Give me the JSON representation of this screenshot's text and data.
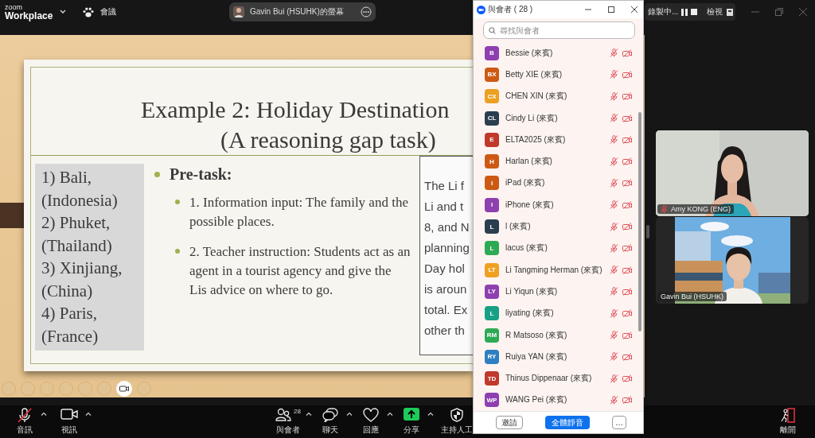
{
  "app_bar": {
    "logo_small": "zoom",
    "logo_large": "Workplace",
    "meeting_label": "會議",
    "share_pill": "Gavin Bui (HSUHK)的螢幕",
    "recording": "錄製中...",
    "view": "檢視"
  },
  "slide": {
    "title": "Example 2: Holiday Destination",
    "subtitle": "(A reasoning gap task)",
    "places": [
      "1) Bali,",
      "(Indonesia)",
      "2) Phuket,",
      "(Thailand)",
      "3) Xinjiang,",
      "(China)",
      "4) Paris,",
      "(France)"
    ],
    "bullet": "Pre-task:",
    "sub_bullets": [
      "1. Information input: The family and the possible places.",
      "2. Teacher instruction: Students act as an agent in a tourist agency and give the Lis advice on where to go."
    ],
    "box_lines": [
      "The Li f",
      "Li and t",
      "8, and N",
      "planning",
      "Day hol",
      "is aroun",
      "total. Ex",
      "other th"
    ]
  },
  "participants_panel": {
    "title": "與會者 ( 28 )",
    "search": {
      "placeholder": "尋找與會者"
    },
    "participants": [
      {
        "initials": "B",
        "name": "Bessie (來賓)",
        "color": "#8e3fb0",
        "audio_muted": true,
        "video_off": true
      },
      {
        "initials": "BX",
        "name": "Betty XIE (來賓)",
        "color": "#cc5a14",
        "audio_muted": true,
        "video_off": true
      },
      {
        "initials": "CX",
        "name": "CHEN XIN (來賓)",
        "color": "#eba022",
        "audio_muted": true,
        "video_off": true
      },
      {
        "initials": "CL",
        "name": "Cindy Li (來賓)",
        "color": "#2b3e50",
        "audio_muted": true,
        "video_off": true
      },
      {
        "initials": "E",
        "name": "ELTA2025 (來賓)",
        "color": "#c0392b",
        "audio_muted": true,
        "video_off": true
      },
      {
        "initials": "H",
        "name": "Harlan (來賓)",
        "color": "#cc5a14",
        "audio_muted": true,
        "video_off": true
      },
      {
        "initials": "I",
        "name": "iPad (來賓)",
        "color": "#cc5a14",
        "audio_muted": true,
        "video_off": true
      },
      {
        "initials": "I",
        "name": "iPhone (來賓)",
        "color": "#8e3fb0",
        "audio_muted": true,
        "video_off": true
      },
      {
        "initials": "L",
        "name": "l (來賓)",
        "color": "#2b3e50",
        "audio_muted": true,
        "video_off": true
      },
      {
        "initials": "L",
        "name": "lacus (來賓)",
        "color": "#2eaa55",
        "audio_muted": true,
        "video_off": true
      },
      {
        "initials": "LT",
        "name": "Li Tangming Herman (來賓)",
        "color": "#f0a020",
        "audio_muted": true,
        "video_off": true
      },
      {
        "initials": "LY",
        "name": "Li Yiqun (來賓)",
        "color": "#8e3fb0",
        "audio_muted": true,
        "video_off": true
      },
      {
        "initials": "L",
        "name": "liyating (來賓)",
        "color": "#17a084",
        "audio_muted": true,
        "video_off": true
      },
      {
        "initials": "RM",
        "name": "R Matsoso (來賓)",
        "color": "#2eaa55",
        "audio_muted": true,
        "video_off": true
      },
      {
        "initials": "RY",
        "name": "Ruiya YAN (來賓)",
        "color": "#2e7fc1",
        "audio_muted": true,
        "video_off": true
      },
      {
        "initials": "TD",
        "name": "Thinus Dippenaar (來賓)",
        "color": "#c0392b",
        "audio_muted": true,
        "video_off": true
      },
      {
        "initials": "WP",
        "name": "WANG Pei (來賓)",
        "color": "#8e3fb0",
        "audio_muted": true,
        "video_off": true
      }
    ],
    "buttons": [
      {
        "label": "邀請",
        "kind": "secondary"
      },
      {
        "label": "全體靜音",
        "kind": "primary"
      },
      {
        "label": "…",
        "kind": "more"
      }
    ]
  },
  "videos": [
    {
      "name": "Amy KONG (ENG)",
      "audio_muted": true,
      "kind": "picture"
    },
    {
      "name": "Gavin Bui (HSUHK)",
      "audio_muted": false,
      "kind": "picture"
    }
  ],
  "toolbar": {
    "items": [
      {
        "label": "音訊",
        "kind": "audio",
        "muted": true,
        "menu": true
      },
      {
        "label": "視訊",
        "kind": "video",
        "menu": true
      },
      {
        "label": "與會者",
        "kind": "participants",
        "count": "28",
        "menu": true
      },
      {
        "label": "聊天",
        "kind": "chat",
        "menu": true
      },
      {
        "label": "回應",
        "kind": "react",
        "menu": true
      },
      {
        "label": "分享",
        "kind": "share",
        "menu": true
      },
      {
        "label": "主持人工",
        "kind": "host",
        "menu": false
      }
    ],
    "leave": "離開"
  }
}
